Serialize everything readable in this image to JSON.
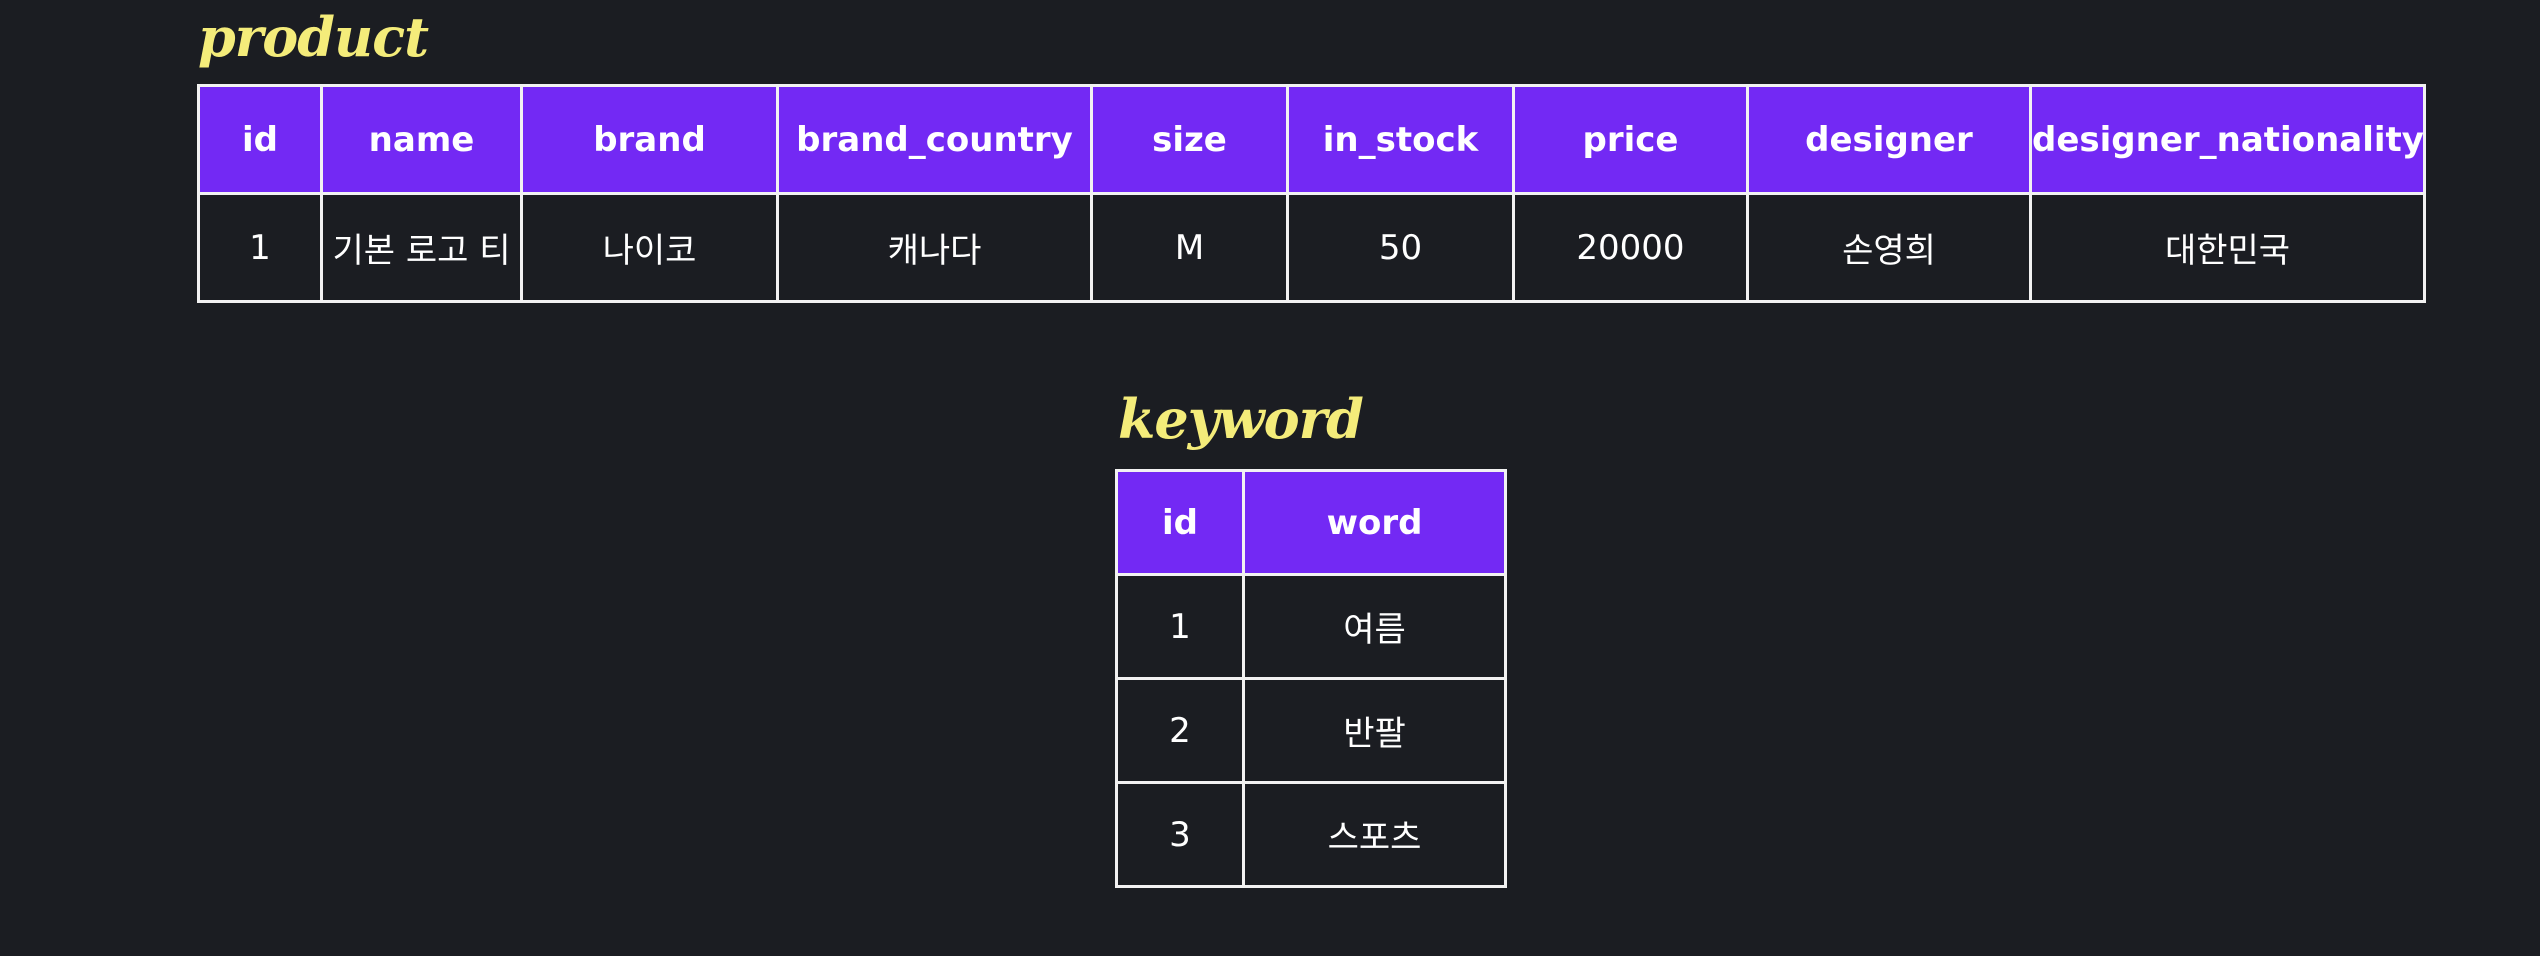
{
  "product": {
    "title": "product",
    "columns": [
      "id",
      "name",
      "brand",
      "brand_country",
      "size",
      "in_stock",
      "price",
      "designer",
      "designer_nationality"
    ],
    "rows": [
      [
        "1",
        "기본 로고 티",
        "나이코",
        "캐나다",
        "M",
        "50",
        "20000",
        "손영희",
        "대한민국"
      ]
    ]
  },
  "keyword": {
    "title": "keyword",
    "columns": [
      "id",
      "word"
    ],
    "rows": [
      [
        "1",
        "여름"
      ],
      [
        "2",
        "반팔"
      ],
      [
        "3",
        "스포츠"
      ]
    ]
  },
  "colors": {
    "background": "#1b1d22",
    "header_fill": "#7329f4",
    "border": "#f2f2f2",
    "title": "#f4ec7a",
    "text": "#ffffff"
  }
}
